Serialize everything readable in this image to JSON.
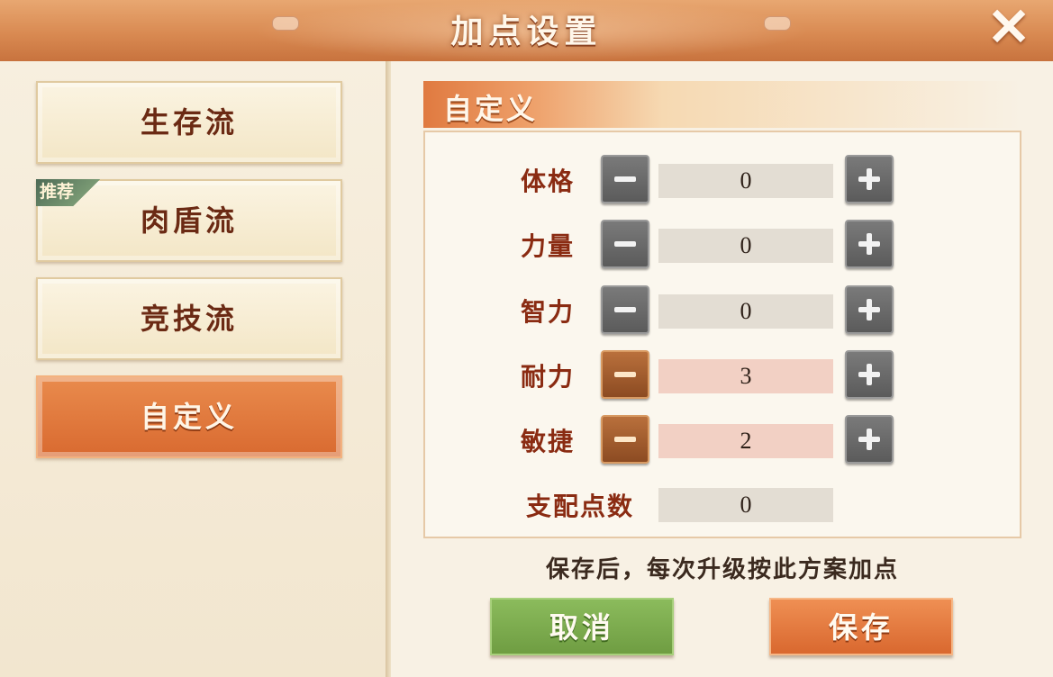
{
  "header": {
    "title": "加点设置",
    "close_label": "✕"
  },
  "plans": [
    {
      "label": "生存流",
      "tag": ""
    },
    {
      "label": "肉盾流",
      "tag": "推荐"
    },
    {
      "label": "竞技流",
      "tag": ""
    },
    {
      "label": "自定义",
      "tag": "",
      "active": true
    }
  ],
  "section": {
    "title": "自定义"
  },
  "stats": [
    {
      "label": "体格",
      "value": "0"
    },
    {
      "label": "力量",
      "value": "0"
    },
    {
      "label": "智力",
      "value": "0"
    },
    {
      "label": "耐力",
      "value": "3"
    },
    {
      "label": "敏捷",
      "value": "2"
    }
  ],
  "remaining": {
    "label": "支配点数",
    "value": "0"
  },
  "hint": "保存后，每次升级按此方案加点",
  "actions": {
    "cancel": "取消",
    "save": "保存"
  },
  "colors": {
    "accent": "#d96a30",
    "stat_label": "#8a2b12",
    "cancel": "#6f9d42"
  }
}
